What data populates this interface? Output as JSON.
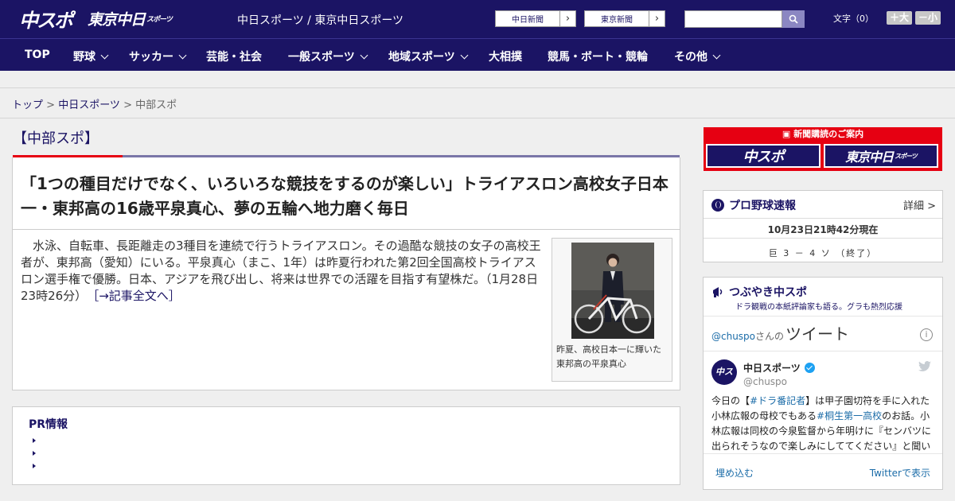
{
  "header": {
    "logo_main": "中スポ",
    "logo_tokyo": "東京中日",
    "logo_tokyo_small": "スポーツ",
    "site_names": "中日スポーツ / 東京中日スポーツ",
    "paper_links": [
      {
        "label": "中日新聞"
      },
      {
        "label": "東京新聞"
      }
    ],
    "search": {
      "value": "",
      "placeholder": ""
    },
    "font_size_label": "文字（0）",
    "font_bigger": "＋大",
    "font_smaller": "－小"
  },
  "nav": [
    {
      "label": "TOP",
      "dropdown": false
    },
    {
      "label": "野球",
      "dropdown": true
    },
    {
      "label": "サッカー",
      "dropdown": true
    },
    {
      "label": "芸能・社会",
      "dropdown": false
    },
    {
      "label": "一般スポーツ",
      "dropdown": true
    },
    {
      "label": "地域スポーツ",
      "dropdown": true
    },
    {
      "label": "大相撲",
      "dropdown": false
    },
    {
      "label": "競馬・ボート・競輪",
      "dropdown": false
    },
    {
      "label": "その他",
      "dropdown": true
    }
  ],
  "breadcrumb": {
    "top": "トップ",
    "sep1": " > ",
    "cat": "中日スポーツ",
    "sep2": " > ",
    "current": "中部スポ"
  },
  "section_title": "【中部スポ】",
  "article": {
    "headline": "「1つの種目だけでなく、いろいろな競技をするのが楽しい」トライアスロン高校女子日本一・東邦高の16歳平泉真心、夢の五輪へ地力磨く毎日",
    "summary": "水泳、自転車、長距離走の3種目を連続で行うトライアスロン。その過酷な競技の女子の高校王者が、東邦高（愛知）にいる。平泉真心（まこ、1年）は昨夏行われた第2回全国高校トライアスロン選手権で優勝。日本、アジアを飛び出し、将来は世界での活躍を目指す有望株だ。（1月28日 23時26分）",
    "more_link": "［→記事全文へ］",
    "photo_caption": "昨夏、高校日本一に輝いた東邦高の平泉真心"
  },
  "pr": {
    "title": "PR情報"
  },
  "sidebar": {
    "subscribe_header": "新聞購読のご案内",
    "subscribe_logo1": "中スポ",
    "subscribe_logo2": "東京中日",
    "subscribe_logo2_small": "スポーツ",
    "score": {
      "title": "プロ野球速報",
      "detail": "詳細 >",
      "time": "10月23日21時42分現在",
      "game": "巨 3 － 4 ソ （終了）"
    },
    "twitter": {
      "title": "つぶやき中スポ",
      "subtitle": "ドラ観戦の本紙評論家も語る。グラも熱烈応援",
      "handle_at": "@chuspo",
      "handle_suffix": "さんの",
      "tweet_word": "ツイート",
      "account_name": "中日スポーツ",
      "account_handle": "@chuspo",
      "text_1": "今日の【",
      "tag_1": "#ドラ番記者",
      "text_2": "】は甲子園切符を手に入れた小林広報の母校でもある",
      "tag_2": "#桐生第一高校",
      "text_3": "のお話。小林広報は同校の今泉監督から年明けに『センバツに出られそうなので楽しみにしててください』と聞い",
      "embed": "埋め込む",
      "view": "Twitterで表示"
    }
  }
}
